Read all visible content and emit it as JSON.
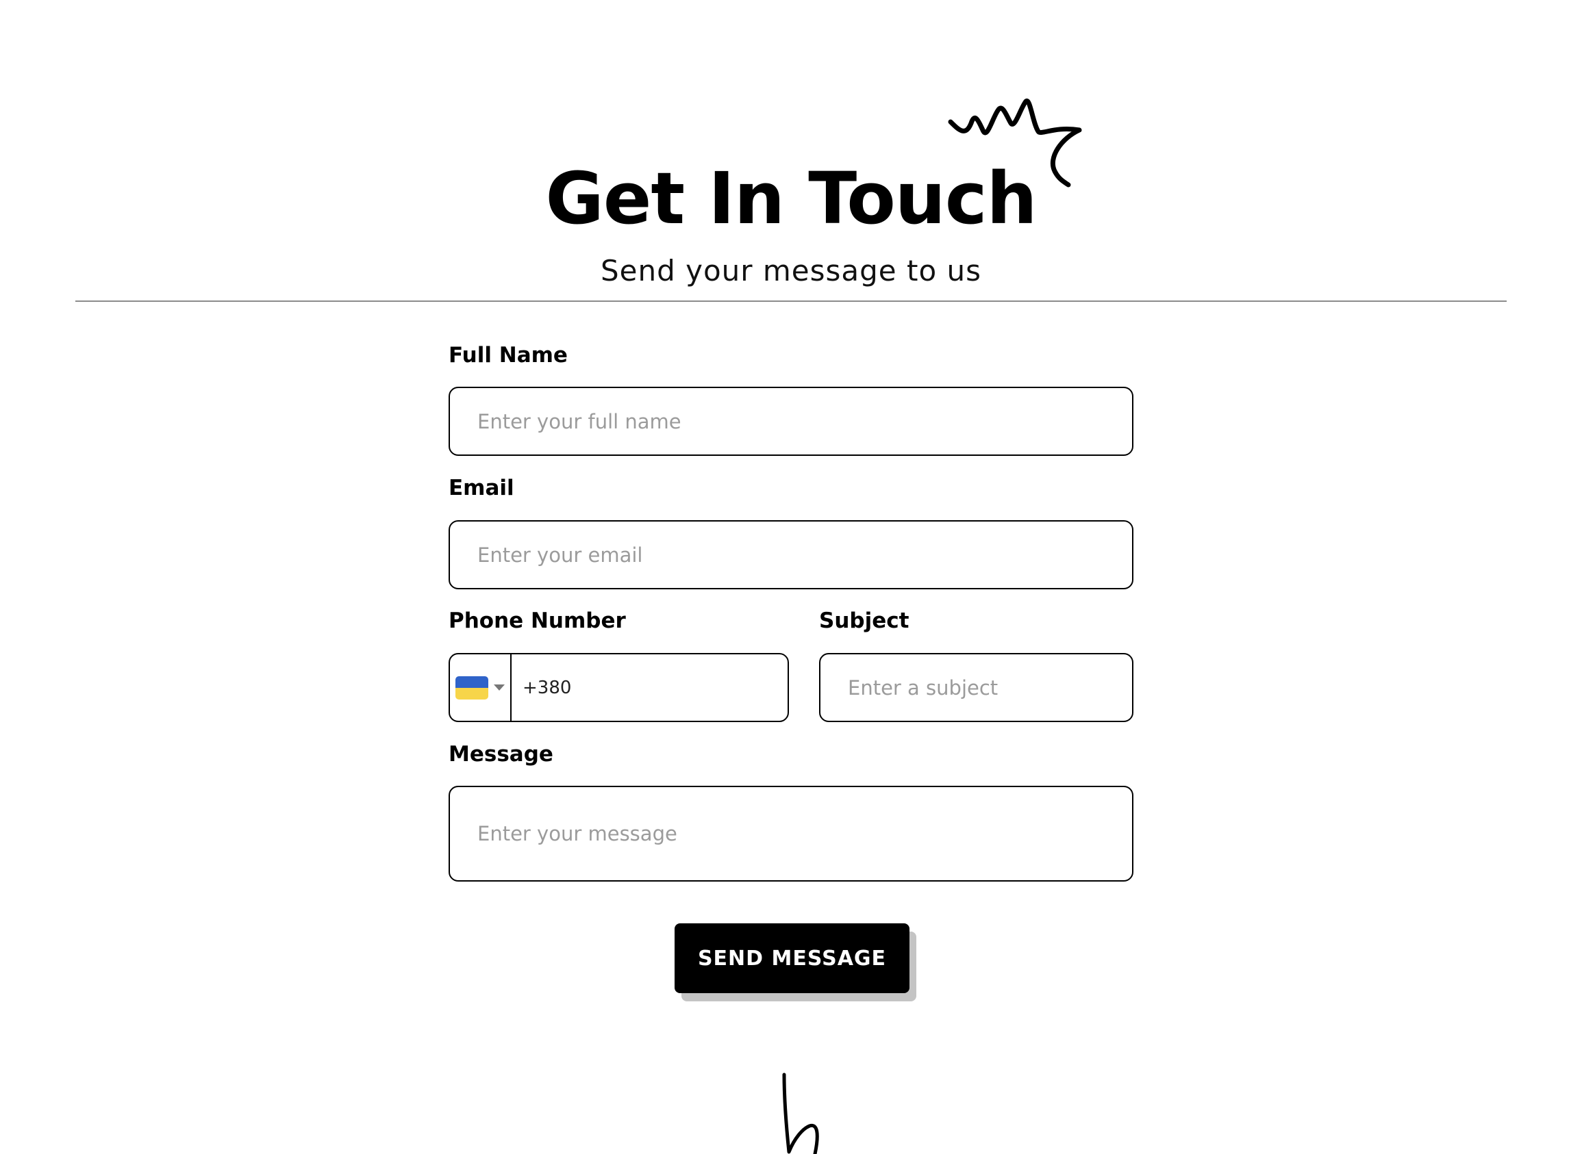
{
  "header": {
    "title": "Get In Touch",
    "subtitle": "Send your message to us"
  },
  "form": {
    "full_name": {
      "label": "Full Name",
      "placeholder": "Enter your full name",
      "value": ""
    },
    "email": {
      "label": "Email",
      "placeholder": "Enter your email",
      "value": ""
    },
    "phone": {
      "label": "Phone Number",
      "country_flag": "ukraine-flag",
      "flag_colors": [
        "#2f63c9",
        "#f7d54a"
      ],
      "value": "+380"
    },
    "subject": {
      "label": "Subject",
      "placeholder": "Enter a subject",
      "value": ""
    },
    "message": {
      "label": "Message",
      "placeholder": "Enter your message",
      "value": ""
    },
    "submit_label": "SEND MESSAGE"
  },
  "theme": {
    "primary": "#000000",
    "background": "#ffffff",
    "placeholder": "#9b9b9b",
    "button_shadow": "#c4c4c4"
  },
  "decorations": {
    "top": "crown-scribble-icon",
    "bottom": "hand-drawn-squiggle-icon"
  }
}
